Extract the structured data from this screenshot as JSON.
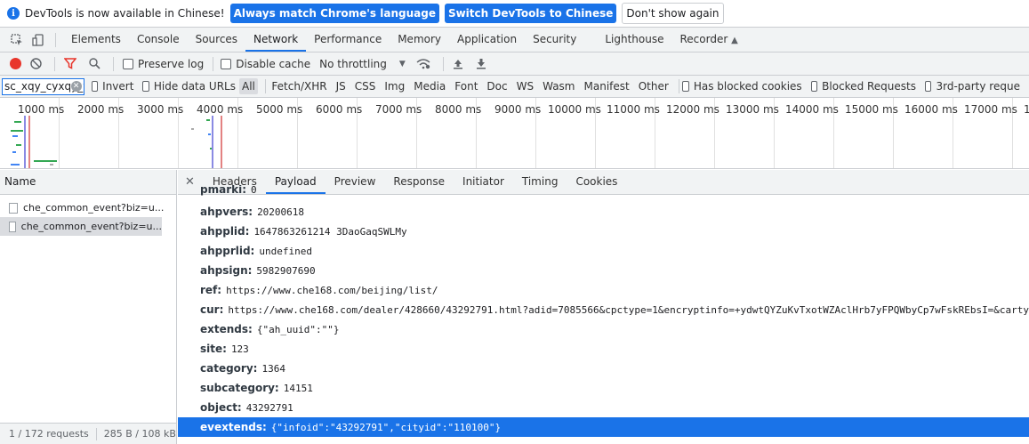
{
  "infobar": {
    "message": "DevTools is now available in Chinese!",
    "btn_match": "Always match Chrome's language",
    "btn_switch": "Switch DevTools to Chinese",
    "btn_dismiss": "Don't show again"
  },
  "tabs": [
    "Elements",
    "Console",
    "Sources",
    "Network",
    "Performance",
    "Memory",
    "Application",
    "Security",
    "Lighthouse",
    "Recorder"
  ],
  "toolbar": {
    "preserve_log": "Preserve log",
    "disable_cache": "Disable cache",
    "throttling": "No throttling"
  },
  "filter": {
    "value": "sc_xqy_cyxqy_wbcxrkdj_click",
    "invert": "Invert",
    "hide_data_urls": "Hide data URLs",
    "types": [
      "All",
      "Fetch/XHR",
      "JS",
      "CSS",
      "Img",
      "Media",
      "Font",
      "Doc",
      "WS",
      "Wasm",
      "Manifest",
      "Other"
    ],
    "has_blocked_cookies": "Has blocked cookies",
    "blocked_requests": "Blocked Requests",
    "third_party": "3rd-party reque"
  },
  "timeline": {
    "ticks": [
      "1000 ms",
      "2000 ms",
      "3000 ms",
      "4000 ms",
      "5000 ms",
      "6000 ms",
      "7000 ms",
      "8000 ms",
      "9000 ms",
      "10000 ms",
      "11000 ms",
      "12000 ms",
      "13000 ms",
      "14000 ms",
      "15000 ms",
      "16000 ms",
      "17000 ms",
      "1"
    ]
  },
  "left": {
    "header": "Name",
    "requests": [
      "che_common_event?biz=u...",
      "che_common_event?biz=u..."
    ],
    "status_requests": "1 / 172 requests",
    "status_size": "285 B / 108 kB"
  },
  "detail": {
    "tabs": [
      "Headers",
      "Payload",
      "Preview",
      "Response",
      "Initiator",
      "Timing",
      "Cookies"
    ],
    "partial_key": "pmarki:",
    "partial_val": "0",
    "rows": [
      {
        "key": "ahpvers:",
        "value": "20200618"
      },
      {
        "key": "ahpplid:",
        "value": "1647863261214 3DaoGaqSWLMy"
      },
      {
        "key": "ahpprlid:",
        "value": "undefined"
      },
      {
        "key": "ahpsign:",
        "value": "5982907690"
      },
      {
        "key": "ref:",
        "value": "https://www.che168.com/beijing/list/"
      },
      {
        "key": "cur:",
        "value": "https://www.che168.com/dealer/428660/43292791.html?adid=7085566&cpctype=1&encryptinfo=+ydwtQYZuKvTxotWZAclHrb7yFPQWbyCp7wFskREbsI=&cartyp"
      },
      {
        "key": "extends:",
        "value": "{\"ah_uuid\":\"\"}"
      },
      {
        "key": "site:",
        "value": "123"
      },
      {
        "key": "category:",
        "value": "1364"
      },
      {
        "key": "subcategory:",
        "value": "14151"
      },
      {
        "key": "object:",
        "value": "43292791"
      },
      {
        "key": "evextends:",
        "value": "{\"infoid\":\"43292791\",\"cityid\":\"110100\"}"
      }
    ]
  }
}
